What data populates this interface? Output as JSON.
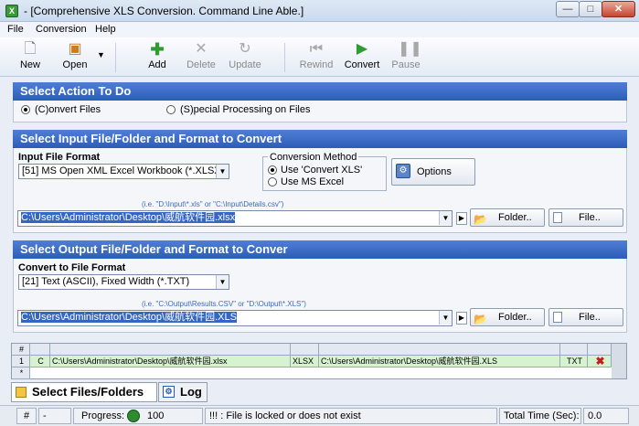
{
  "window": {
    "title": "- [Comprehensive XLS Conversion.  Command Line Able.]",
    "app_icon": "X"
  },
  "menu": [
    "File",
    "Conversion",
    "Help"
  ],
  "toolbar": {
    "new": "New",
    "open": "Open",
    "add": "Add",
    "delete": "Delete",
    "update": "Update",
    "rewind": "Rewind",
    "convert": "Convert",
    "pause": "Pause"
  },
  "action": {
    "header": "Select Action To Do",
    "convert_files": "(C)onvert Files",
    "special": "(S)pecial Processing on Files"
  },
  "input": {
    "header": "Select Input File/Folder and Format to Convert",
    "format_label": "Input File Format",
    "format_value": "[51] MS Open XML Excel Workbook (*.XLSX)",
    "method_label": "Conversion Method",
    "method_convert": "Use 'Convert XLS'",
    "method_excel": "Use MS Excel",
    "options": "Options",
    "hint": "(i.e. \"D:\\Input\\*.xls\"  or \"C:\\Input\\Details.csv\")",
    "path": "C:\\Users\\Administrator\\Desktop\\威航软件园.xlsx",
    "folder": "Folder..",
    "file": "File.."
  },
  "output": {
    "header": "Select Output File/Folder and Format to Conver",
    "format_label": "Convert to File Format",
    "format_value": "[21] Text (ASCII), Fixed Width (*.TXT)",
    "hint": "(i.e. \"C:\\Output\\Results.CSV\" or \"D:\\Output\\*.XLS\")",
    "path": "C:\\Users\\Administrator\\Desktop\\威航软件园.XLS",
    "folder": "Folder..",
    "file": "File.."
  },
  "grid": {
    "header_num": "#",
    "row": {
      "num": "1",
      "action": "C",
      "input": "C:\\Users\\Administrator\\Desktop\\威航软件园.xlsx",
      "in_fmt": "XLSX",
      "output": "C:\\Users\\Administrator\\Desktop\\威航软件园.XLS",
      "out_fmt": "TXT"
    },
    "new_row": "*"
  },
  "tabs": {
    "files": "Select Files/Folders",
    "log": "Log"
  },
  "status": {
    "num_label": "#",
    "num_value": "-",
    "progress_label": "Progress:",
    "progress_value": "100",
    "message": "!!! :  File is locked or does not exist",
    "time_label": "Total Time (Sec):",
    "time_value": "0.0"
  }
}
